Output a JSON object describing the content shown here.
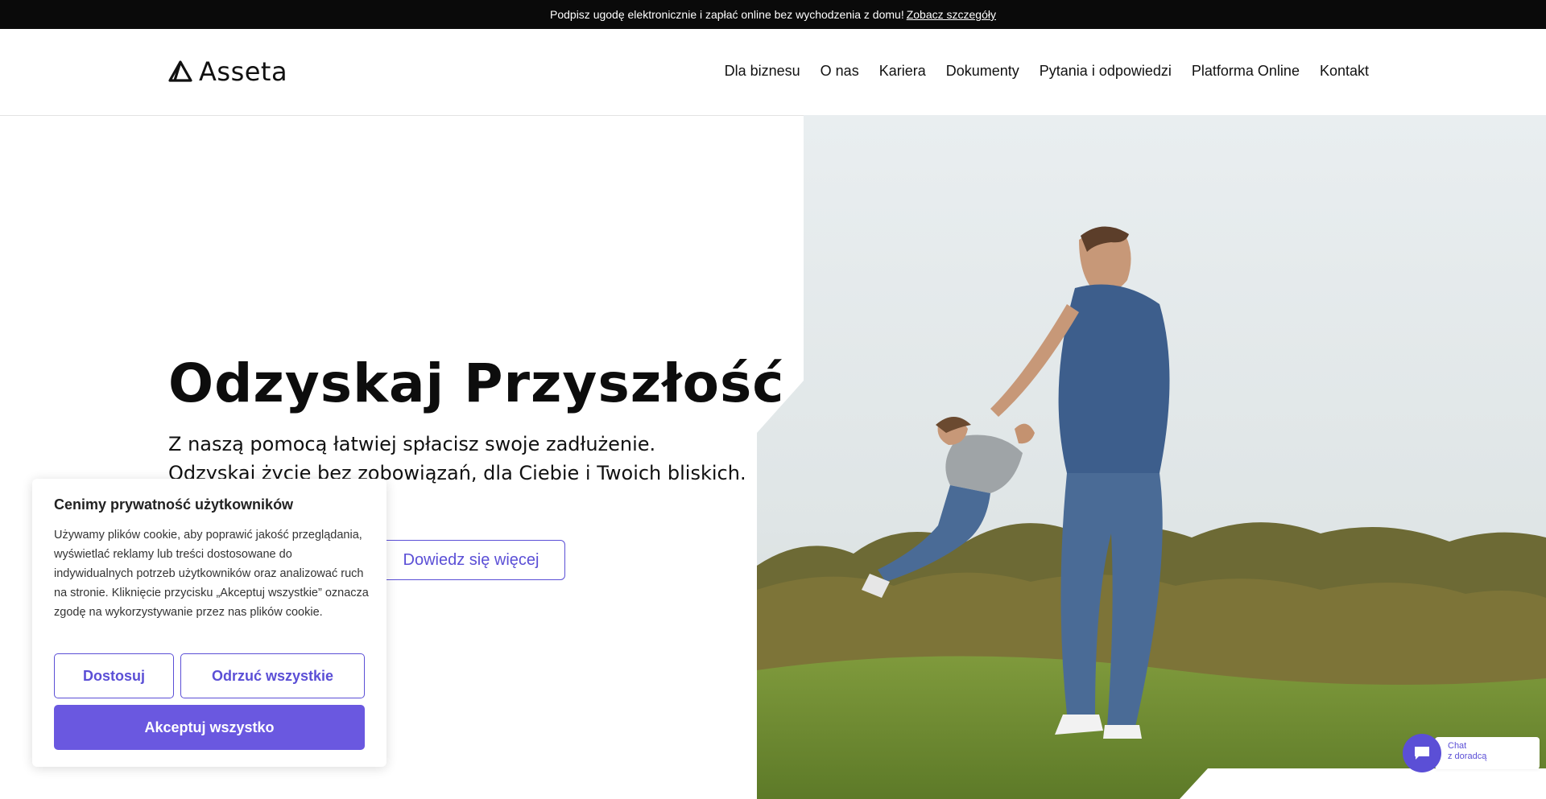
{
  "topbar": {
    "text": "Podpisz ugodę elektronicznie i zapłać online bez wychodzenia z domu!",
    "link": "Zobacz szczegóły"
  },
  "header": {
    "logo_text": "Asseta",
    "nav": [
      "Dla biznesu",
      "O nas",
      "Kariera",
      "Dokumenty",
      "Pytania i odpowiedzi",
      "Platforma Online",
      "Kontakt"
    ]
  },
  "hero": {
    "title": "Odzyskaj Przyszłość",
    "subtitle_line1": "Z naszą pomocą łatwiej spłacisz swoje zadłużenie.",
    "subtitle_line2": "Odzyskaj życie bez zobowiązań, dla Ciebie i Twoich bliskich.",
    "more_button": "Dowiedz się więcej",
    "more_link_fragment": "ej"
  },
  "cookie": {
    "title": "Cenimy prywatność użytkowników",
    "text": "Używamy plików cookie, aby poprawić jakość przeglądania, wyświetlać reklamy lub treści dostosowane do indywidualnych potrzeb użytkowników oraz analizować ruch na stronie. Kliknięcie przycisku „Akceptuj wszystkie” oznacza zgodę na wykorzystywanie przez nas plików cookie.",
    "customize": "Dostosuj",
    "reject_all": "Odrzuć wszystkie",
    "accept_all": "Akceptuj wszystko"
  },
  "chat": {
    "line1": "Chat",
    "line2": "z doradcą"
  },
  "colors": {
    "accent": "#5b4fd6",
    "accent_fill": "#6a58e0",
    "topbar_bg": "#0a0a0a"
  },
  "icons": {
    "logo": "triangle-logo-icon",
    "chat": "chat-bubble-icon"
  }
}
